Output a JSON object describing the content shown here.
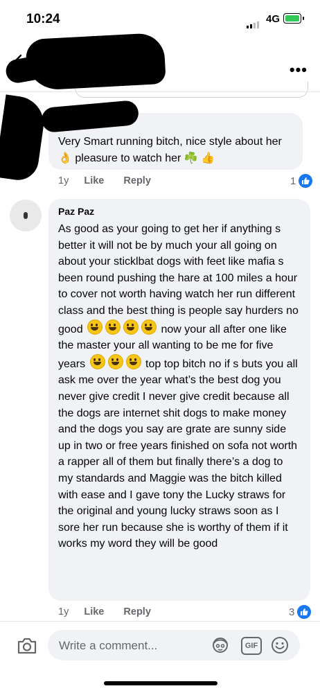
{
  "status_bar": {
    "time": "10:24",
    "network": "4G",
    "battery_color": "#34c759"
  },
  "comments": [
    {
      "text": "Very Smart running bitch, nice style about her 👌 pleasure to watch her ☘️ 👍",
      "age": "1y",
      "like_label": "Like",
      "reply_label": "Reply",
      "reaction_count": "1"
    },
    {
      "author": "Paz Paz",
      "text_1": "As good as your going to get her if anything s better it will not be by much your all going on about your sticklbat dogs with feet like mafia s been round pushing the hare at 100 miles a hour to cover  not worth having watch her run different class and the best thing is people say hurders no good",
      "text_2": "now your all after one like the master your all wanting to be me for five years",
      "text_3": "top top bitch no if s buts you all ask me over the year what’s the best dog you never give credit I never give credit because all the dogs are internet shit dogs to make money and the dogs you say are grate are sunny side up in two or free years finished on sofa not worth a rapper all of them but finally there’s a dog to my standards and Maggie was the bitch killed with ease and I gave tony the Lucky straws for the original and young lucky straws soon as I sore her run because she is worthy of them if it works my word they will be good",
      "age": "1y",
      "like_label": "Like",
      "reply_label": "Reply",
      "reaction_count": "3"
    }
  ],
  "composer": {
    "placeholder": "Write a comment...",
    "gif_label": "GIF"
  },
  "colors": {
    "accent": "#1877f2",
    "bubble": "#f0f2f5",
    "meta_text": "#65676b"
  },
  "icons": [
    "back-arrow-icon",
    "more-icon",
    "like-thumb-icon",
    "camera-icon",
    "avatar-sticker-icon",
    "gif-icon",
    "emoji-icon"
  ]
}
